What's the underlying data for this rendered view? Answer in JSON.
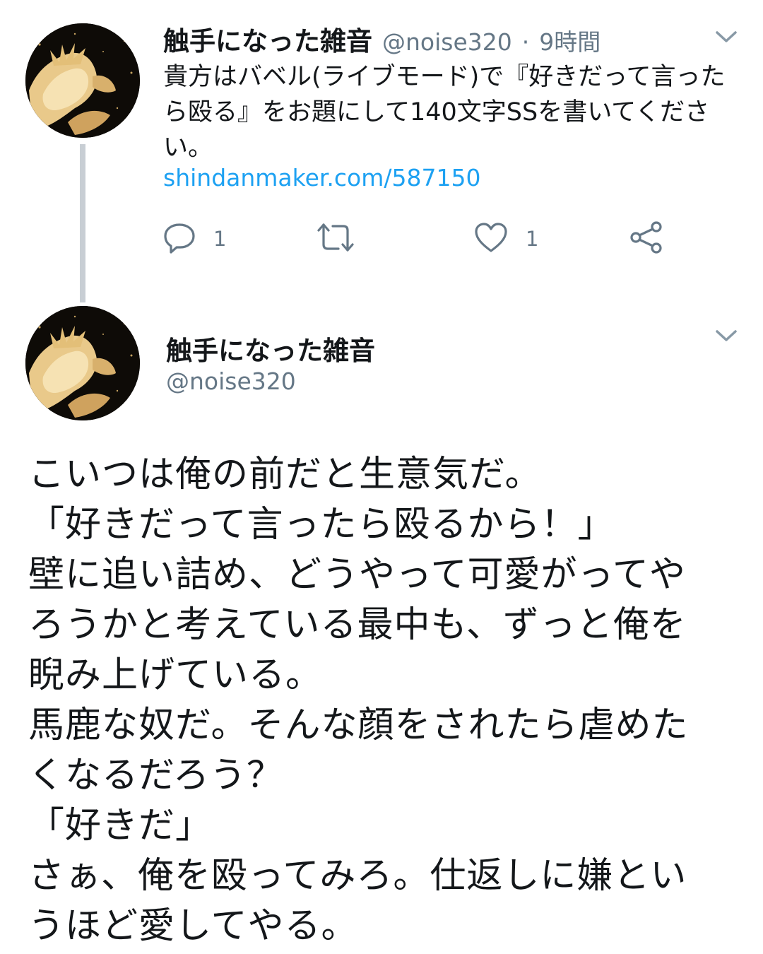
{
  "tweet1": {
    "author_name": "触手になった雑音",
    "handle": "@noise320",
    "separator": "·",
    "time": "9時間",
    "text": "貴方はバベル(ライブモード)で『好きだって言ったら殴る』をお題にして140文字SSを書いてください。",
    "link": "shindanmaker.com/587150",
    "reply_count": "1",
    "retweet_count": "",
    "like_count": "1"
  },
  "tweet2": {
    "author_name": "触手になった雑音",
    "handle": "@noise320",
    "body_lines": [
      "こいつは俺の前だと生意気だ。",
      "「好きだって言ったら殴るから！」",
      "壁に追い詰め、どうやって可愛がってや",
      "ろうかと考えている最中も、ずっと俺を",
      "睨み上げている。",
      "馬鹿な奴だ。そんな顔をされたら虐めた",
      "くなるだろう？",
      "「好きだ」",
      "さぁ、俺を殴ってみろ。仕返しに嫌とい",
      "うほど愛してやる。"
    ]
  },
  "icons": {
    "reply": "reply-icon",
    "retweet": "retweet-icon",
    "like": "heart-icon",
    "share": "share-icon",
    "menu": "chevron-down-icon",
    "avatar": "avatar"
  },
  "colors": {
    "link": "#1da1f2",
    "secondary_text": "#657786",
    "thread_line": "#c8ced4"
  }
}
